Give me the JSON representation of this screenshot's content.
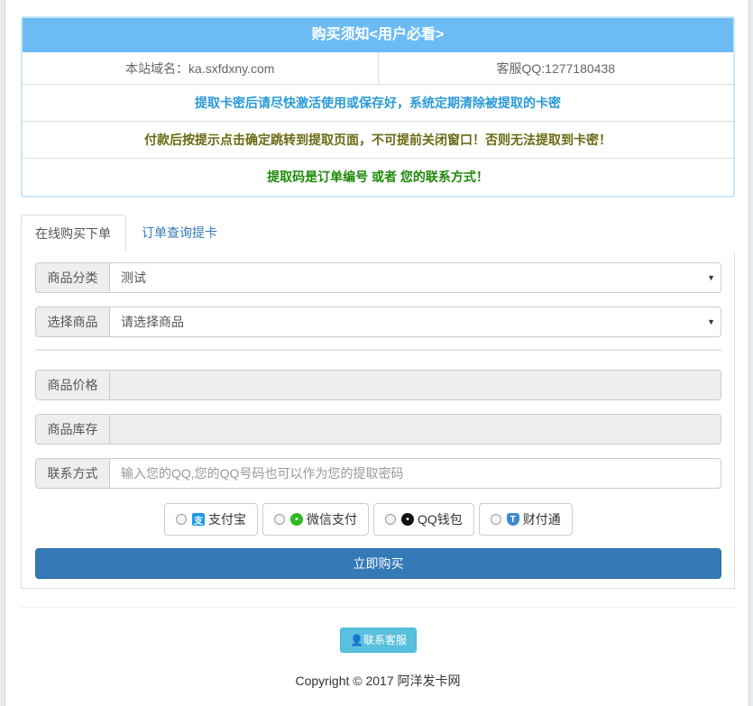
{
  "notice": {
    "title": "购买须知<用户必看>",
    "domain": "本站域名：ka.sxfdxny.com",
    "qq": "客服QQ:1277180438",
    "line1": "提取卡密后请尽快激活使用或保存好，系统定期清除被提取的卡密",
    "line2": "付款后按提示点击确定跳转到提取页面，不可提前关闭窗口！否则无法提取到卡密！",
    "line3": "提取码是订单编号 或者 您的联系方式！"
  },
  "tabs": {
    "buy": "在线购买下单",
    "query": "订单查询提卡"
  },
  "form": {
    "category_label": "商品分类",
    "category_value": "测试",
    "product_label": "选择商品",
    "product_value": "请选择商品",
    "price_label": "商品价格",
    "price_value": "",
    "stock_label": "商品库存",
    "stock_value": "",
    "contact_label": "联系方式",
    "contact_placeholder": "输入您的QQ,您的QQ号码也可以作为您的提取密码"
  },
  "payments": {
    "alipay": "支付宝",
    "wechat": "微信支付",
    "qqwallet": "QQ钱包",
    "tenpay": "财付通"
  },
  "buy_button": "立即购买",
  "contact_button": "联系客服",
  "copyright": "Copyright © 2017 阿洋发卡网",
  "colors": {
    "header": "#6bbcf4",
    "primary": "#337ab7",
    "info": "#5bc0de"
  }
}
